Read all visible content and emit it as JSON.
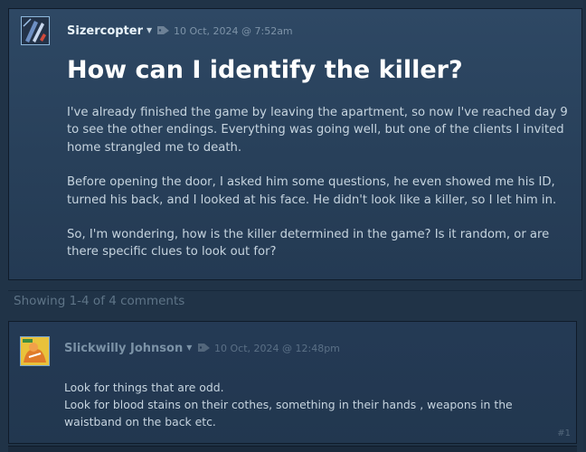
{
  "original_post": {
    "author": "Sizercopter",
    "timestamp": "10 Oct, 2024 @ 7:52am",
    "title": "How can I identify the killer?",
    "paragraphs": [
      "I've already finished the game by leaving the apartment, so now I've reached day 9 to see the other endings. Everything was going well, but one of the clients I invited home strangled me to death.",
      "Before opening the door, I asked him some questions, he even showed me his ID, turned his back, and I looked at his face. He didn't look like a killer, so I let him in.",
      "So, I'm wondering, how is the killer determined in the game? Is it random, or are there specific clues to look out for?"
    ]
  },
  "comments_info": "Showing 1-4 of 4 comments",
  "comments": [
    {
      "author": "Slickwilly Johnson",
      "timestamp": "10 Oct, 2024 @ 12:48pm",
      "lines": [
        "Look for things that are odd.",
        "Look for blood stains on their cothes, something in their hands , weapons in the waistband on the back etc."
      ],
      "number": "#1"
    }
  ],
  "icons": {
    "author_dropdown": "chevron-down-icon",
    "post_tag": "pencil-tag-icon"
  }
}
